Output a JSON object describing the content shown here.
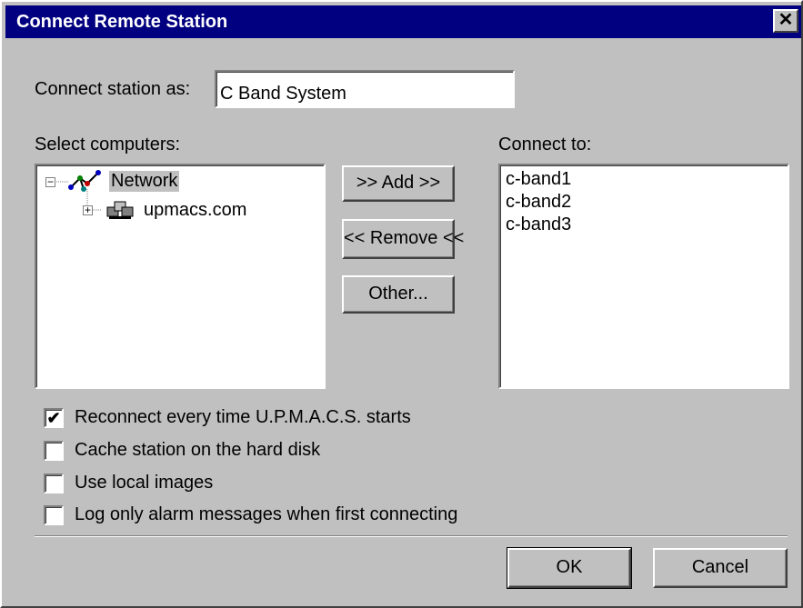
{
  "window": {
    "title": "Connect Remote Station",
    "close_glyph": "✕"
  },
  "station_name": {
    "label": "Connect station as:",
    "value": "C Band System"
  },
  "select_computers": {
    "label": "Select computers:",
    "tree": [
      {
        "label": "Network",
        "icon": "network-icon",
        "expander": "−"
      },
      {
        "label": "upmacs.com",
        "icon": "domain-icon",
        "expander": "+"
      }
    ]
  },
  "buttons": {
    "add": ">> Add >>",
    "remove": "<< Remove <<",
    "other": "Other...",
    "ok": "OK",
    "cancel": "Cancel"
  },
  "connect_to": {
    "label": "Connect to:",
    "items": [
      "c-band1",
      "c-band2",
      "c-band3"
    ]
  },
  "options": [
    {
      "label": "Reconnect every time U.P.M.A.C.S. starts",
      "checked": true
    },
    {
      "label": "Cache station on the hard disk",
      "checked": false
    },
    {
      "label": "Use local images",
      "checked": false
    },
    {
      "label": "Log only alarm messages when first connecting",
      "checked": false
    }
  ],
  "check_glyph": "✔"
}
